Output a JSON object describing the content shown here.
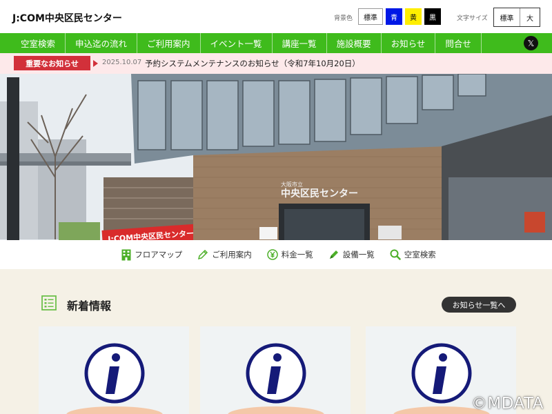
{
  "header": {
    "site_title": "J:COM中央区民センター",
    "bg_label": "背景色",
    "bg_options": [
      "標準",
      "青",
      "黄",
      "黒"
    ],
    "fontsize_label": "文字サイズ",
    "fontsize_options": [
      "標準",
      "大"
    ]
  },
  "nav": {
    "items": [
      "空室検索",
      "申込迄の流れ",
      "ご利用案内",
      "イベント一覧",
      "講座一覧",
      "施設概要",
      "お知らせ",
      "問合せ"
    ],
    "x_label": "𝕏"
  },
  "notice": {
    "badge": "重要なお知らせ",
    "date": "2025.10.07",
    "text": "予約システムメンテナンスのお知らせ（令和7年10月20日）"
  },
  "hero": {
    "banner_text": "J:COM中央区民センター",
    "sign_small": "大阪市立",
    "sign_large": "中央区民センター"
  },
  "quick_links": [
    {
      "label": "フロアマップ",
      "icon": "building-icon"
    },
    {
      "label": "ご利用案内",
      "icon": "pencil-icon"
    },
    {
      "label": "料金一覧",
      "icon": "yen-icon"
    },
    {
      "label": "設備一覧",
      "icon": "pen-icon"
    },
    {
      "label": "空室検索",
      "icon": "search-icon"
    }
  ],
  "news": {
    "title": "新着情報",
    "all_button": "お知らせ一覧へ",
    "cards": [
      {
        "icon": "info-icon"
      },
      {
        "icon": "info-icon"
      },
      {
        "icon": "info-icon"
      }
    ]
  },
  "copyright": "©MDATA",
  "colors": {
    "nav_green": "#3fbb1c",
    "notice_red": "#d2303a",
    "notice_bg": "#fde9ea",
    "news_bg": "#f5f1e6",
    "info_navy": "#151a78"
  }
}
